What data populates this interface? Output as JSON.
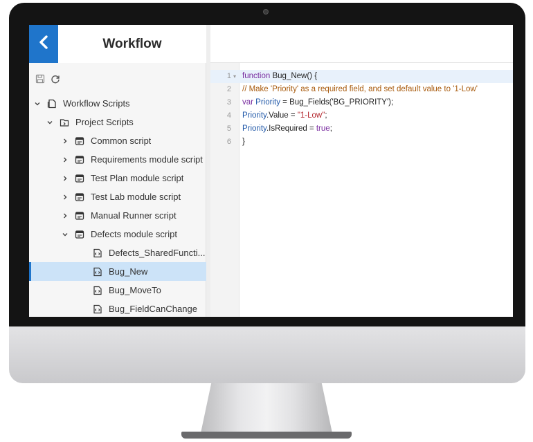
{
  "header": {
    "title": "Workflow"
  },
  "toolbar": {
    "save_icon": "save-icon",
    "refresh_icon": "refresh-icon"
  },
  "tree": {
    "root": {
      "label": "Workflow Scripts"
    },
    "project": {
      "label": "Project Scripts"
    },
    "modules": [
      {
        "label": "Common script"
      },
      {
        "label": "Requirements module script"
      },
      {
        "label": "Test Plan module script"
      },
      {
        "label": "Test Lab module script"
      },
      {
        "label": "Manual Runner script"
      },
      {
        "label": "Defects module script"
      }
    ],
    "functions": [
      {
        "label": "Defects_SharedFuncti..."
      },
      {
        "label": "Bug_New"
      },
      {
        "label": "Bug_MoveTo"
      },
      {
        "label": "Bug_FieldCanChange"
      }
    ]
  },
  "editor": {
    "line_numbers": [
      "1",
      "2",
      "3",
      "4",
      "5",
      "6"
    ],
    "lines": [
      {
        "kw": "function",
        "fn": " Bug_New() {"
      },
      {
        "comment": "//  Make 'Priority' as a required field, and set default value to '1-Low'"
      },
      {
        "kw": "var",
        "var": " Priority",
        "plain": " = Bug_Fields('BG_PRIORITY');"
      },
      {
        "var": "Priority",
        "plain": ".Value = ",
        "str": "\"1-Low\"",
        "end": ";"
      },
      {
        "var": "Priority",
        "plain": ".IsRequired = ",
        "kw": "true",
        "end": ";"
      },
      {
        "plain": "}"
      }
    ]
  },
  "colors": {
    "accent": "#1f75cb",
    "selected_row": "#cce3f8"
  }
}
